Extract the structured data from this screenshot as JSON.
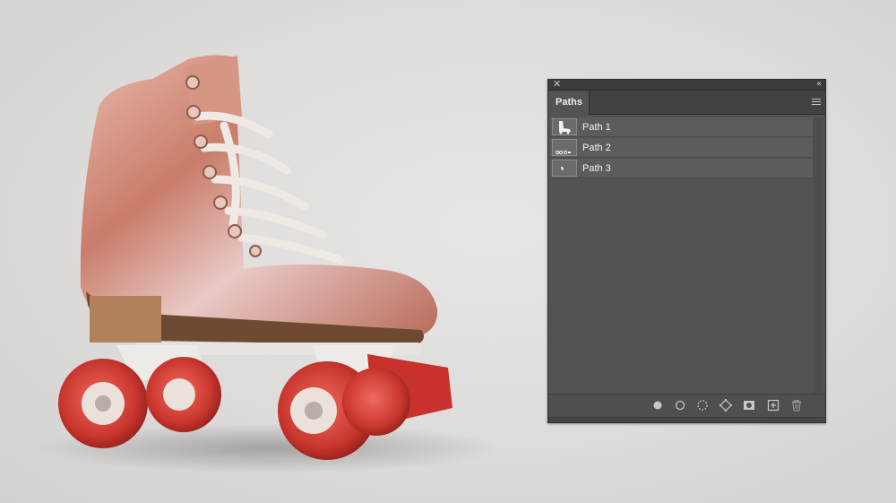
{
  "panel": {
    "tab_label": "Paths",
    "icons": {
      "close": "close-icon",
      "collapse": "collapse-double-chevron-icon",
      "menu": "panel-menu-icon"
    },
    "paths": [
      {
        "name": "Path 1",
        "thumb_icon": "path-thumbnail-skate-icon"
      },
      {
        "name": "Path 2",
        "thumb_icon": "path-thumbnail-wheels-icon"
      },
      {
        "name": "Path 3",
        "thumb_icon": "path-thumbnail-small-icon"
      }
    ],
    "bottom_tools": [
      "fill-path-icon",
      "stroke-path-icon",
      "load-selection-icon",
      "make-work-path-icon",
      "add-mask-icon",
      "new-path-icon",
      "trash-icon"
    ]
  },
  "colors": {
    "panel_bg": "#535353",
    "panel_header": "#424242",
    "row_bg": "#5c5c5c",
    "text": "#f2f2f2",
    "skate_leather": "#cf8a78",
    "wheel_red": "#d4423a"
  }
}
